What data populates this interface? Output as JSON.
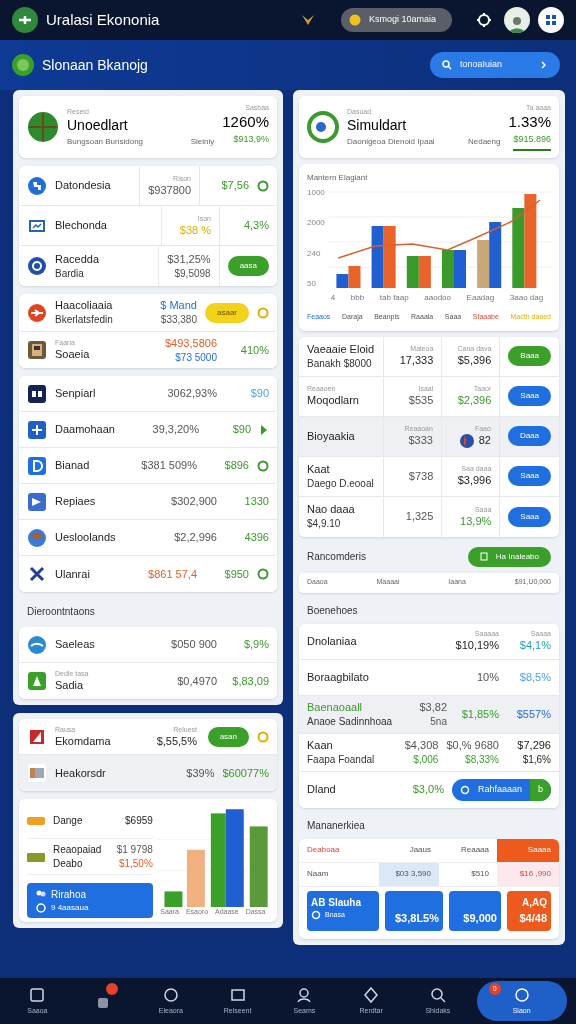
{
  "top_bar": {
    "app_title": "Uralasi Ekononia",
    "status_pill": "Ksmogi 10amaia"
  },
  "sub_header": {
    "title": "Slonaan Bkanojg",
    "search_button": "tonoaIuian"
  },
  "left_panels": [
    {
      "blocks": [
        {
          "kind": "header",
          "caption": "Reseid",
          "title": "Unoedlart",
          "subtitle": "Bungsoan Bunsidong",
          "meta": "Sieiniy",
          "value_caption": "Sasbaa",
          "value": "1260%",
          "change": "$913,9%",
          "underlined": false
        },
        {
          "kind": "table",
          "icons": true,
          "rows": [
            {
              "label": "Datondesia",
              "cells": [
                {
                  "kind": "value",
                  "caption": "Rison",
                  "lines": [
                    {
                      "text": "$937800",
                      "kind": "muted"
                    }
                  ]
                },
                {
                  "kind": "value",
                  "lines": [
                    {
                      "text": "$7,56",
                      "kind": "positive"
                    }
                  ]
                }
              ],
              "end_icon": {
                "kind": "circle",
                "color": "#3a9a2a"
              }
            },
            {
              "label": "Blechonda",
              "cells": [
                {
                  "kind": "value",
                  "caption": "Ison",
                  "lines": [
                    {
                      "text": "$38 %",
                      "kind": "warning"
                    }
                  ]
                },
                {
                  "kind": "value",
                  "lines": [
                    {
                      "text": "4,3%",
                      "kind": "positive"
                    }
                  ]
                }
              ]
            },
            {
              "label": "Racedda",
              "sub": "Bardia",
              "cells": [
                {
                  "kind": "value",
                  "lines": [
                    {
                      "text": "$31,25%",
                      "kind": "muted"
                    },
                    {
                      "text": "$9,5098",
                      "kind": "muted"
                    }
                  ]
                },
                {
                  "kind": "pill",
                  "pill": {
                    "text": "aasa",
                    "kind": "positive"
                  }
                }
              ]
            }
          ]
        },
        {
          "kind": "list",
          "icons": true,
          "rows": [
            {
              "label": "Haacoliaaia",
              "sub": "Bkerlatsfedin",
              "cells": [
                {
                  "kind": "value",
                  "lines": [
                    {
                      "text": "$ Mand",
                      "kind": "info"
                    },
                    {
                      "text": "$33,380",
                      "kind": "muted"
                    }
                  ]
                },
                {
                  "kind": "pill",
                  "pill": {
                    "text": "asaar",
                    "kind": "warning"
                  }
                }
              ],
              "end_icon": {
                "kind": "circle",
                "color": "#e0b000"
              }
            },
            {
              "caption": "Faaria",
              "label": "Soaeia",
              "cells": [
                {
                  "kind": "value",
                  "lines": [
                    {
                      "text": "$493,5806",
                      "kind": "negative"
                    },
                    {
                      "text": "$73 5000",
                      "kind": "info"
                    }
                  ]
                },
                {
                  "kind": "value",
                  "lines": [
                    {
                      "text": "410%",
                      "kind": "positive"
                    }
                  ]
                }
              ]
            }
          ]
        },
        {
          "kind": "list",
          "icons": true,
          "rows": [
            {
              "label": "Senpiarl",
              "cells": [
                {
                  "kind": "value",
                  "lines": [
                    {
                      "text": "3062,93%",
                      "kind": "muted"
                    }
                  ]
                },
                {
                  "kind": "value",
                  "lines": [
                    {
                      "text": "$90",
                      "kind": "soft"
                    }
                  ]
                }
              ]
            },
            {
              "label": "Daamohaan",
              "cells": [
                {
                  "kind": "value",
                  "lines": [
                    {
                      "text": "39,3,20%",
                      "kind": "muted"
                    }
                  ]
                },
                {
                  "kind": "value",
                  "lines": [
                    {
                      "text": "$90",
                      "kind": "positive"
                    }
                  ]
                }
              ],
              "end_icon": {
                "kind": "chevron",
                "color": "#3a9a2a"
              }
            },
            {
              "label": "Bianad",
              "cells": [
                {
                  "kind": "value",
                  "lines": [
                    {
                      "text": "$381 509%",
                      "kind": "muted"
                    }
                  ]
                },
                {
                  "kind": "value",
                  "lines": [
                    {
                      "text": "$896",
                      "kind": "positive"
                    }
                  ]
                }
              ],
              "end_icon": {
                "kind": "circle",
                "color": "#3a9a2a"
              }
            },
            {
              "label": "Repiaes",
              "cells": [
                {
                  "kind": "value",
                  "lines": [
                    {
                      "text": "$302,900",
                      "kind": "muted"
                    }
                  ]
                },
                {
                  "kind": "value",
                  "lines": [
                    {
                      "text": "1330",
                      "kind": "positive"
                    }
                  ]
                }
              ]
            },
            {
              "label": "Uesloolands",
              "cells": [
                {
                  "kind": "value",
                  "lines": [
                    {
                      "text": "$2,2,996",
                      "kind": "muted"
                    }
                  ]
                },
                {
                  "kind": "value",
                  "lines": [
                    {
                      "text": "4396",
                      "kind": "positive"
                    }
                  ]
                }
              ]
            },
            {
              "label": "Ulanrai",
              "cells": [
                {
                  "kind": "value",
                  "lines": [
                    {
                      "text": "$861 57,4",
                      "kind": "negative"
                    }
                  ]
                },
                {
                  "kind": "value",
                  "lines": [
                    {
                      "text": "$950",
                      "kind": "positive"
                    }
                  ]
                }
              ],
              "end_icon": {
                "kind": "circle",
                "color": "#3a9a2a"
              }
            }
          ]
        },
        {
          "kind": "label",
          "text": "Dieroontntaons"
        },
        {
          "kind": "list",
          "icons": true,
          "rows": [
            {
              "label": "Saeleas",
              "cells": [
                {
                  "kind": "value",
                  "lines": [
                    {
                      "text": "$050 900",
                      "kind": "muted"
                    }
                  ]
                },
                {
                  "kind": "value",
                  "lines": [
                    {
                      "text": "$,9%",
                      "kind": "positive"
                    }
                  ]
                }
              ]
            },
            {
              "caption": "Dedie tasa",
              "label": "Sadia",
              "cells": [
                {
                  "kind": "value",
                  "lines": [
                    {
                      "text": "$0,4970",
                      "kind": "muted"
                    }
                  ]
                },
                {
                  "kind": "value",
                  "lines": [
                    {
                      "text": "$,83,09",
                      "kind": "positive"
                    }
                  ]
                }
              ]
            }
          ]
        }
      ]
    },
    {
      "blocks": [
        {
          "kind": "list",
          "icons": true,
          "rows": [
            {
              "caption": "Rausa",
              "label": "Ekomdama",
              "shaded": false,
              "cells": [
                {
                  "kind": "value",
                  "caption": "Reluest",
                  "lines": [
                    {
                      "text": "$,55,5%",
                      "kind": "plain"
                    }
                  ]
                },
                {
                  "kind": "pill",
                  "pill": {
                    "text": "asan",
                    "kind": "positive"
                  }
                }
              ],
              "end_icon": {
                "kind": "circle",
                "color": "#e0b000"
              }
            },
            {
              "label": "Heakorsdr",
              "shaded": true,
              "cells": [
                {
                  "kind": "value",
                  "lines": [
                    {
                      "text": "$39%",
                      "kind": "muted"
                    }
                  ]
                },
                {
                  "kind": "value",
                  "lines": [
                    {
                      "text": "$60077%",
                      "kind": "positive"
                    }
                  ]
                }
              ]
            }
          ]
        },
        {
          "kind": "bar_panel",
          "rows": [
            {
              "label": "Dange",
              "values": [
                {
                  "text": "$6959",
                  "kind": "plain"
                }
              ]
            },
            {
              "label": "Reaopaiad",
              "sub": "Deabo",
              "values": [
                {
                  "text": "$1 9798",
                  "kind": "muted"
                },
                {
                  "text": "$1,50%",
                  "kind": "negative"
                }
              ]
            }
          ],
          "card": {
            "title": "Rirahoa",
            "subtitle": "9 4aasaua"
          },
          "categories": [
            "Saara",
            "Esaoro",
            "Adaase",
            "Dassa"
          ]
        }
      ]
    }
  ],
  "right_panel": {
    "blocks": [
      {
        "kind": "header",
        "caption": "Dasuad",
        "title": "Simuldart",
        "subtitle": "Daonigeoa Dienoid Ipaai",
        "meta": "Nedaeng",
        "value_caption": "Ta aaaa",
        "value": "1.33%",
        "change": "$915.896",
        "underlined": true
      },
      {
        "kind": "chart",
        "title": "Mantern Elagiant",
        "y_labels": [
          "1000",
          "2000",
          "240",
          "50"
        ],
        "categories": [
          "4",
          "bbb",
          "tab faap",
          "aaodoo",
          "Eaadag",
          "3aao dag"
        ],
        "legend": [
          {
            "text": "Feaaos",
            "kind": "info"
          },
          {
            "text": "Daraja",
            "kind": "muted"
          },
          {
            "text": "Beanpis",
            "kind": "muted"
          },
          {
            "text": "Raaala",
            "kind": "muted"
          },
          {
            "text": "Saaa",
            "kind": "muted"
          },
          {
            "text": "Sfaaabe",
            "kind": "alert"
          },
          {
            "text": "Macth daaed",
            "kind": "warning"
          }
        ]
      },
      {
        "kind": "table",
        "rows": [
          {
            "label": "Vaeaaie Eloid",
            "sub": "Banakh $8000",
            "shaded": false,
            "cells": [
              {
                "kind": "value",
                "caption": "Maleoa",
                "lines": [
                  {
                    "text": "17,333",
                    "kind": "plain"
                  }
                ]
              },
              {
                "kind": "value",
                "caption": "Cana dava",
                "lines": [
                  {
                    "text": "$5,396",
                    "kind": "plain"
                  }
                ]
              },
              {
                "kind": "pill",
                "pill": {
                  "text": "Baaa",
                  "kind": "positive"
                }
              }
            ]
          },
          {
            "caption": "Reaaoen",
            "label": "Moqodlarn",
            "shaded": false,
            "cells": [
              {
                "kind": "value",
                "caption": "Isaal",
                "lines": [
                  {
                    "text": "$535",
                    "kind": "muted"
                  }
                ]
              },
              {
                "kind": "value",
                "caption": "Taaor",
                "lines": [
                  {
                    "text": "$2,396",
                    "kind": "positive"
                  }
                ]
              },
              {
                "kind": "pill",
                "pill": {
                  "text": "Saaa",
                  "kind": "info"
                }
              }
            ]
          },
          {
            "label": "Bioyaakia",
            "shaded": true,
            "cells": [
              {
                "kind": "value",
                "caption": "Reaaoan",
                "lines": [
                  {
                    "text": "$333",
                    "kind": "muted"
                  }
                ]
              },
              {
                "kind": "flagged",
                "caption": "Faao",
                "lines": [
                  {
                    "text": "82",
                    "kind": "plain"
                  }
                ]
              },
              {
                "kind": "pill",
                "pill": {
                  "text": "Daaa",
                  "kind": "info"
                }
              }
            ]
          },
          {
            "label": "Kaat",
            "sub": "Daego D.eooal",
            "shaded": false,
            "cells": [
              {
                "kind": "value",
                "lines": [
                  {
                    "text": "$738",
                    "kind": "muted"
                  }
                ]
              },
              {
                "kind": "value",
                "caption": "Saa daaa",
                "lines": [
                  {
                    "text": "$3,996",
                    "kind": "plain"
                  }
                ]
              },
              {
                "kind": "pill",
                "pill": {
                  "text": "Saaa",
                  "kind": "info"
                }
              }
            ]
          },
          {
            "label": "Nao daaa",
            "sub": "$4,9.10",
            "shaded": false,
            "cells": [
              {
                "kind": "value",
                "lines": [
                  {
                    "text": "1,325",
                    "kind": "muted"
                  }
                ]
              },
              {
                "kind": "value",
                "caption": "Saaa",
                "lines": [
                  {
                    "text": "13,9%",
                    "kind": "positive"
                  }
                ]
              },
              {
                "kind": "pill",
                "pill": {
                  "text": "Saaa",
                  "kind": "info"
                }
              }
            ]
          }
        ]
      },
      {
        "kind": "section",
        "title": "Rancomderis",
        "button": "Ha Inaleabo"
      },
      {
        "kind": "strip",
        "cells": [
          "Daaoa",
          "Maaaai",
          "Iaana",
          "$91,U0,000"
        ]
      },
      {
        "kind": "label",
        "text": "Boenehoes"
      },
      {
        "kind": "list",
        "rows": [
          {
            "label": "Dnolaniaa",
            "shaded": false,
            "cells": [
              {
                "kind": "value",
                "caption": "Saaaaa",
                "lines": [
                  {
                    "text": "$10,19%",
                    "kind": "plain"
                  }
                ]
              },
              {
                "kind": "value",
                "caption": "Saaaa",
                "lines": [
                  {
                    "text": "$4,1%",
                    "kind": "cool"
                  }
                ]
              }
            ]
          },
          {
            "label": "Boraagbilato",
            "shaded": false,
            "cells": [
              {
                "kind": "value",
                "lines": [
                  {
                    "text": "10%",
                    "kind": "muted"
                  }
                ]
              },
              {
                "kind": "value",
                "lines": [
                  {
                    "text": "$8,5%",
                    "kind": "soft"
                  }
                ]
              }
            ]
          },
          {
            "label": "Baenaoaall",
            "sub": "Anaoe Sadinnhoaa",
            "shaded": true,
            "cells": [
              {
                "kind": "value",
                "lines": [
                  {
                    "text": "$3,82",
                    "kind": "muted"
                  },
                  {
                    "text": "5na",
                    "kind": "muted"
                  }
                ]
              },
              {
                "kind": "value",
                "lines": [
                  {
                    "text": "$1,85%",
                    "kind": "positive"
                  }
                ]
              },
              {
                "kind": "value",
                "lines": [
                  {
                    "text": "$557%",
                    "kind": "info"
                  }
                ]
              }
            ]
          },
          {
            "label": "Kaan",
            "sub": "Faapa Foandal",
            "shaded": false,
            "cells": [
              {
                "kind": "value",
                "lines": [
                  {
                    "text": "$4,308",
                    "kind": "muted"
                  },
                  {
                    "text": "$,006",
                    "kind": "positive"
                  }
                ]
              },
              {
                "kind": "value",
                "lines": [
                  {
                    "text": "$0,% 9680",
                    "kind": "muted"
                  },
                  {
                    "text": "$8,33%",
                    "kind": "positive"
                  }
                ]
              },
              {
                "kind": "value",
                "lines": [
                  {
                    "text": "$7,296",
                    "kind": "plain"
                  },
                  {
                    "text": "$1,6%",
                    "kind": "plain"
                  }
                ]
              }
            ]
          },
          {
            "label": "Dland",
            "shaded": false,
            "cells": [
              {
                "kind": "value",
                "lines": [
                  {
                    "text": "$3,0%",
                    "kind": "positive"
                  }
                ]
              },
              {
                "kind": "split",
                "split": {
                  "text": "Rahfaaaan",
                  "end": "b"
                }
              }
            ]
          }
        ]
      },
      {
        "kind": "label",
        "text": "Mananerkiea"
      },
      {
        "kind": "matrix",
        "header": [
          {
            "text": "Deaboaa",
            "kind": "title"
          },
          {
            "text": "Jaaus",
            "kind": "plain"
          },
          {
            "text": "Reaaaa",
            "kind": "plain"
          },
          {
            "text": "Saaaa",
            "kind": "accent"
          }
        ],
        "row": [
          {
            "text": "Naam",
            "kind": "plain"
          },
          {
            "text": "$03 3,590",
            "kind": "tinted"
          },
          {
            "text": "$510",
            "kind": "plain"
          },
          {
            "text": "$16 ,990",
            "kind": "pink"
          }
        ],
        "tiles": [
          {
            "title": "AB Slauha",
            "subtitle": "Bnasa",
            "kind": "primary"
          },
          {
            "value": "$3,8L5%",
            "kind": "primary"
          },
          {
            "value": "$9,000",
            "kind": "primary"
          },
          {
            "title": "A,AQ",
            "value": "$4/48",
            "kind": "accent"
          }
        ]
      }
    ]
  },
  "bottom_nav": [
    {
      "label": "Saaoa",
      "has_badge": false,
      "selected": false
    },
    {
      "has_badge": true,
      "selected": false
    },
    {
      "label": "Eleaora",
      "has_badge": false,
      "selected": false
    },
    {
      "label": "Relseent",
      "has_badge": false,
      "selected": false
    },
    {
      "label": "Seams",
      "has_badge": false,
      "selected": false
    },
    {
      "label": "Rerdtar",
      "has_badge": false,
      "selected": false
    },
    {
      "label": "Shidaks",
      "has_badge": false,
      "selected": false
    },
    {
      "label": "Siaon",
      "has_badge": true,
      "badge_text": "0",
      "selected": true
    }
  ]
}
